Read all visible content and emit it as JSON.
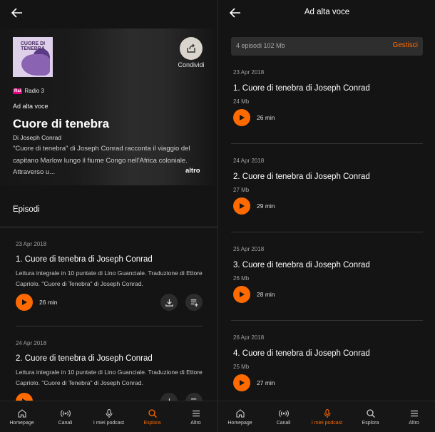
{
  "left": {
    "cover_title": "CUORE DI TENEBRA",
    "share_label": "Condividi",
    "network_logo": "Rai",
    "network_name": "Radio 3",
    "category": "Ad alta voce",
    "title": "Cuore di tenebra",
    "author": "Di Joseph Conrad",
    "description": "\"Cuore di tenebra\" di Joseph Conrad racconta il viaggio del capitano Marlow lungo il fiume Congo nell'Africa coloniale. Attraverso u...",
    "more_label": "altro",
    "tab_label": "Episodi",
    "episodes": [
      {
        "date": "23 Apr 2018",
        "title": "1. Cuore di tenebra di Joseph Conrad",
        "description": "Lettura integrale in 10 puntate di Lino Guanciale. Traduzione di Ettore Capriolo. \"Cuore di Tenebra\" di Joseph Conrad.",
        "duration": "26 min"
      },
      {
        "date": "24 Apr 2018",
        "title": "2. Cuore di tenebra di Joseph Conrad",
        "description": "Lettura integrale in 10 puntate di Lino Guanciale. Traduzione di Ettore Capriolo. \"Cuore di Tenebra\" di Joseph Conrad.",
        "duration": ""
      }
    ]
  },
  "right": {
    "header_title": "Ad alta voce",
    "download_info": "4 episodi 102 Mb",
    "manage_label": "Gestisci",
    "episodes": [
      {
        "date": "23 Apr 2018",
        "title": "1. Cuore di tenebra di Joseph Conrad",
        "size": "24 Mb",
        "duration": "26 min"
      },
      {
        "date": "24 Apr 2018",
        "title": "2. Cuore di tenebra di Joseph Conrad",
        "size": "27 Mb",
        "duration": "29 min"
      },
      {
        "date": "25 Apr 2018",
        "title": "3. Cuore di tenebra di Joseph Conrad",
        "size": "26 Mb",
        "duration": "28 min"
      },
      {
        "date": "26 Apr 2018",
        "title": "4. Cuore di tenebra di Joseph Conrad",
        "size": "25 Mb",
        "duration": "27 min"
      }
    ]
  },
  "nav": {
    "items": [
      "Homepage",
      "Canali",
      "I miei podcast",
      "Esplora",
      "Altro"
    ],
    "left_active": "Esplora",
    "right_active": "I miei podcast"
  },
  "icons": {
    "back": "arrow-left-icon",
    "share": "share-icon",
    "play": "play-icon",
    "download": "download-icon",
    "add_to_queue": "playlist-add-icon",
    "home": "home-icon",
    "channels": "broadcast-icon",
    "podcasts": "microphone-icon",
    "explore": "search-icon",
    "more": "menu-icon"
  },
  "colors": {
    "accent": "#ff6a00",
    "background": "#141414",
    "rai_brand": "#e4007f"
  }
}
